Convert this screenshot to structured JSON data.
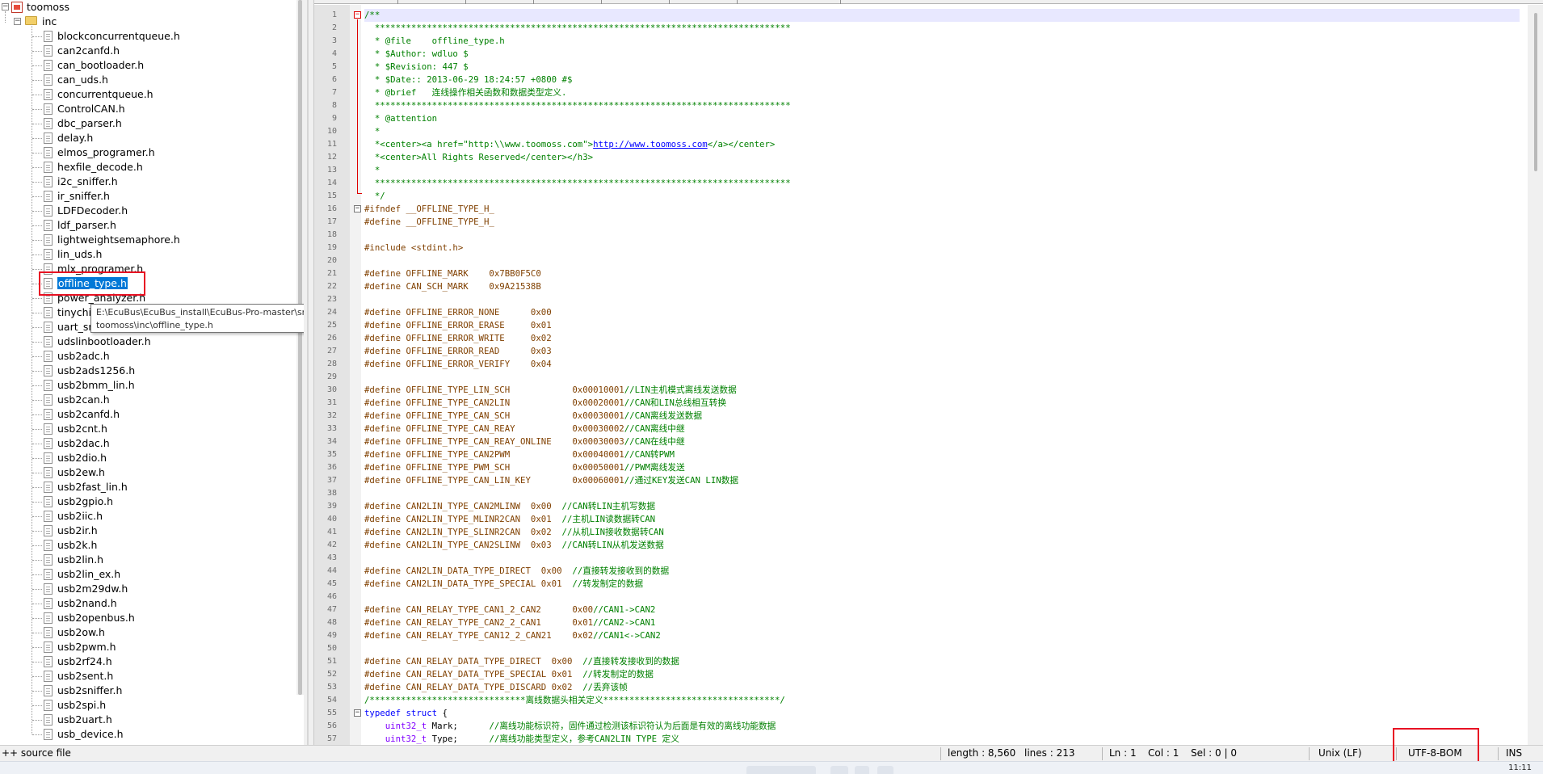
{
  "tree": {
    "root": "toomoss",
    "folder": "inc",
    "files": [
      "blockconcurrentqueue.h",
      "can2canfd.h",
      "can_bootloader.h",
      "can_uds.h",
      "concurrentqueue.h",
      "ControlCAN.h",
      "dbc_parser.h",
      "delay.h",
      "elmos_programer.h",
      "hexfile_decode.h",
      "i2c_sniffer.h",
      "ir_sniffer.h",
      "LDFDecoder.h",
      "ldf_parser.h",
      "lightweightsemaphore.h",
      "lin_uds.h",
      "mlx_programer.h",
      "offline_type.h",
      "power_analyzer.h",
      "tinychip_isp.h",
      "uart_sniffer.h",
      "udslinbootloader.h",
      "usb2adc.h",
      "usb2ads1256.h",
      "usb2bmm_lin.h",
      "usb2can.h",
      "usb2canfd.h",
      "usb2cnt.h",
      "usb2dac.h",
      "usb2dio.h",
      "usb2ew.h",
      "usb2fast_lin.h",
      "usb2gpio.h",
      "usb2iic.h",
      "usb2ir.h",
      "usb2k.h",
      "usb2lin.h",
      "usb2lin_ex.h",
      "usb2m29dw.h",
      "usb2nand.h",
      "usb2openbus.h",
      "usb2ow.h",
      "usb2pwm.h",
      "usb2rf24.h",
      "usb2sent.h",
      "usb2sniffer.h",
      "usb2spi.h",
      "usb2uart.h",
      "usb_device.h"
    ],
    "selected": "offline_type.h",
    "tooltip_line1": "E:\\EcuBus\\EcuBus_install\\EcuBus-Pro-master\\src\\main\\docan\\",
    "tooltip_line2": "toomoss\\inc\\offline_type.h"
  },
  "editor": {
    "line_numbers": [
      "1",
      "2",
      "3",
      "4",
      "5",
      "6",
      "7",
      "8",
      "9",
      "10",
      "11",
      "12",
      "13",
      "14",
      "15",
      "16",
      "17",
      "18",
      "19",
      "20",
      "21",
      "22",
      "23",
      "24",
      "25",
      "26",
      "27",
      "28",
      "29",
      "30",
      "31",
      "32",
      "33",
      "34",
      "35",
      "36",
      "37",
      "38",
      "39",
      "40",
      "41",
      "42",
      "43",
      "44",
      "45",
      "46",
      "47",
      "48",
      "49",
      "50",
      "51",
      "52",
      "53",
      "54",
      "55",
      "56",
      "57"
    ],
    "lines": [
      [
        [
          "cmt",
          "/**"
        ]
      ],
      [
        [
          "cmt",
          "  ********************************************************************************"
        ]
      ],
      [
        [
          "cmt",
          "  * @file    offline_type.h"
        ]
      ],
      [
        [
          "cmt",
          "  * $Author: wdluo $"
        ]
      ],
      [
        [
          "cmt",
          "  * $Revision: 447 $"
        ]
      ],
      [
        [
          "cmt",
          "  * $Date:: 2013-06-29 18:24:57 +0800 #$"
        ]
      ],
      [
        [
          "cmt",
          "  * @brief   连线操作相关函数和数据类型定义."
        ]
      ],
      [
        [
          "cmt",
          "  ********************************************************************************"
        ]
      ],
      [
        [
          "cmt",
          "  * @attention"
        ]
      ],
      [
        [
          "cmt",
          "  *"
        ]
      ],
      [
        [
          "cmt",
          "  *<center><a href=\"http:\\\\www.toomoss.com\">"
        ],
        [
          "lnk",
          "http://www.toomoss.com"
        ],
        [
          "cmt",
          "</a></center>"
        ]
      ],
      [
        [
          "cmt",
          "  *<center>All Rights Reserved</center></h3>"
        ]
      ],
      [
        [
          "cmt",
          "  *"
        ]
      ],
      [
        [
          "cmt",
          "  ********************************************************************************"
        ]
      ],
      [
        [
          "cmt",
          "  */"
        ]
      ],
      [
        [
          "pp",
          "#ifndef __OFFLINE_TYPE_H_"
        ]
      ],
      [
        [
          "pp",
          "#define __OFFLINE_TYPE_H_"
        ]
      ],
      [
        [
          "txt",
          ""
        ]
      ],
      [
        [
          "pp",
          "#include <stdint.h>"
        ]
      ],
      [
        [
          "txt",
          ""
        ]
      ],
      [
        [
          "pp",
          "#define OFFLINE_MARK    0x7BB0F5C0"
        ]
      ],
      [
        [
          "pp",
          "#define CAN_SCH_MARK    0x9A21538B"
        ]
      ],
      [
        [
          "txt",
          ""
        ]
      ],
      [
        [
          "pp",
          "#define OFFLINE_ERROR_NONE      0x00"
        ]
      ],
      [
        [
          "pp",
          "#define OFFLINE_ERROR_ERASE     0x01"
        ]
      ],
      [
        [
          "pp",
          "#define OFFLINE_ERROR_WRITE     0x02"
        ]
      ],
      [
        [
          "pp",
          "#define OFFLINE_ERROR_READ      0x03"
        ]
      ],
      [
        [
          "pp",
          "#define OFFLINE_ERROR_VERIFY    0x04"
        ]
      ],
      [
        [
          "txt",
          ""
        ]
      ],
      [
        [
          "pp",
          "#define OFFLINE_TYPE_LIN_SCH            0x00010001"
        ],
        [
          "cmt",
          "//LIN主机模式离线发送数据"
        ]
      ],
      [
        [
          "pp",
          "#define OFFLINE_TYPE_CAN2LIN            0x00020001"
        ],
        [
          "cmt",
          "//CAN和LIN总线相互转换"
        ]
      ],
      [
        [
          "pp",
          "#define OFFLINE_TYPE_CAN_SCH            0x00030001"
        ],
        [
          "cmt",
          "//CAN离线发送数据"
        ]
      ],
      [
        [
          "pp",
          "#define OFFLINE_TYPE_CAN_REAY           0x00030002"
        ],
        [
          "cmt",
          "//CAN离线中继"
        ]
      ],
      [
        [
          "pp",
          "#define OFFLINE_TYPE_CAN_REAY_ONLINE    0x00030003"
        ],
        [
          "cmt",
          "//CAN在线中继"
        ]
      ],
      [
        [
          "pp",
          "#define OFFLINE_TYPE_CAN2PWM            0x00040001"
        ],
        [
          "cmt",
          "//CAN转PWM"
        ]
      ],
      [
        [
          "pp",
          "#define OFFLINE_TYPE_PWM_SCH            0x00050001"
        ],
        [
          "cmt",
          "//PWM离线发送"
        ]
      ],
      [
        [
          "pp",
          "#define OFFLINE_TYPE_CAN_LIN_KEY        0x00060001"
        ],
        [
          "cmt",
          "//通过KEY发送CAN LIN数据"
        ]
      ],
      [
        [
          "txt",
          ""
        ]
      ],
      [
        [
          "pp",
          "#define CAN2LIN_TYPE_CAN2MLINW  0x00  "
        ],
        [
          "cmt",
          "//CAN转LIN主机写数据"
        ]
      ],
      [
        [
          "pp",
          "#define CAN2LIN_TYPE_MLINR2CAN  0x01  "
        ],
        [
          "cmt",
          "//主机LIN读数据转CAN"
        ]
      ],
      [
        [
          "pp",
          "#define CAN2LIN_TYPE_SLINR2CAN  0x02  "
        ],
        [
          "cmt",
          "//从机LIN接收数据转CAN"
        ]
      ],
      [
        [
          "pp",
          "#define CAN2LIN_TYPE_CAN2SLINW  0x03  "
        ],
        [
          "cmt",
          "//CAN转LIN从机发送数据"
        ]
      ],
      [
        [
          "txt",
          ""
        ]
      ],
      [
        [
          "pp",
          "#define CAN2LIN_DATA_TYPE_DIRECT  0x00  "
        ],
        [
          "cmt",
          "//直接转发接收到的数据"
        ]
      ],
      [
        [
          "pp",
          "#define CAN2LIN_DATA_TYPE_SPECIAL 0x01  "
        ],
        [
          "cmt",
          "//转发制定的数据"
        ]
      ],
      [
        [
          "txt",
          ""
        ]
      ],
      [
        [
          "pp",
          "#define CAN_RELAY_TYPE_CAN1_2_CAN2      0x00"
        ],
        [
          "cmt",
          "//CAN1->CAN2"
        ]
      ],
      [
        [
          "pp",
          "#define CAN_RELAY_TYPE_CAN2_2_CAN1      0x01"
        ],
        [
          "cmt",
          "//CAN2->CAN1"
        ]
      ],
      [
        [
          "pp",
          "#define CAN_RELAY_TYPE_CAN12_2_CAN21    0x02"
        ],
        [
          "cmt",
          "//CAN1<->CAN2"
        ]
      ],
      [
        [
          "txt",
          ""
        ]
      ],
      [
        [
          "pp",
          "#define CAN_RELAY_DATA_TYPE_DIRECT  0x00  "
        ],
        [
          "cmt",
          "//直接转发接收到的数据"
        ]
      ],
      [
        [
          "pp",
          "#define CAN_RELAY_DATA_TYPE_SPECIAL 0x01  "
        ],
        [
          "cmt",
          "//转发制定的数据"
        ]
      ],
      [
        [
          "pp",
          "#define CAN_RELAY_DATA_TYPE_DISCARD 0x02  "
        ],
        [
          "cmt",
          "//丢弃该帧"
        ]
      ],
      [
        [
          "cmt",
          "/******************************离线数据头相关定义**********************************/"
        ]
      ],
      [
        [
          "kw",
          "typedef struct "
        ],
        [
          "txt",
          "{"
        ]
      ],
      [
        [
          "txt",
          "    "
        ],
        [
          "typ",
          "uint32_t"
        ],
        [
          "txt",
          " Mark;      "
        ],
        [
          "cmt",
          "//离线功能标识符，固件通过检测该标识符认为后面是有效的离线功能数据"
        ]
      ],
      [
        [
          "txt",
          "    "
        ],
        [
          "typ",
          "uint32_t"
        ],
        [
          "txt",
          " Type;      "
        ],
        [
          "cmt",
          "//离线功能类型定义，参考CAN2LIN TYPE 定义"
        ]
      ]
    ]
  },
  "status": {
    "file_type": "++ source file",
    "length": "length : 8,560",
    "lines": "lines : 213",
    "ln": "Ln : 1",
    "col": "Col : 1",
    "sel": "Sel : 0 | 0",
    "eol": "Unix (LF)",
    "encoding": "UTF-8-BOM",
    "mode": "INS"
  },
  "taskbar": {
    "clock": "11:11"
  },
  "colors": {
    "selection": "#0078d7",
    "highlight_box": "#e81123",
    "comment": "#008000",
    "preprocessor": "#804000",
    "keyword": "#0000ff",
    "type": "#8000ff"
  }
}
